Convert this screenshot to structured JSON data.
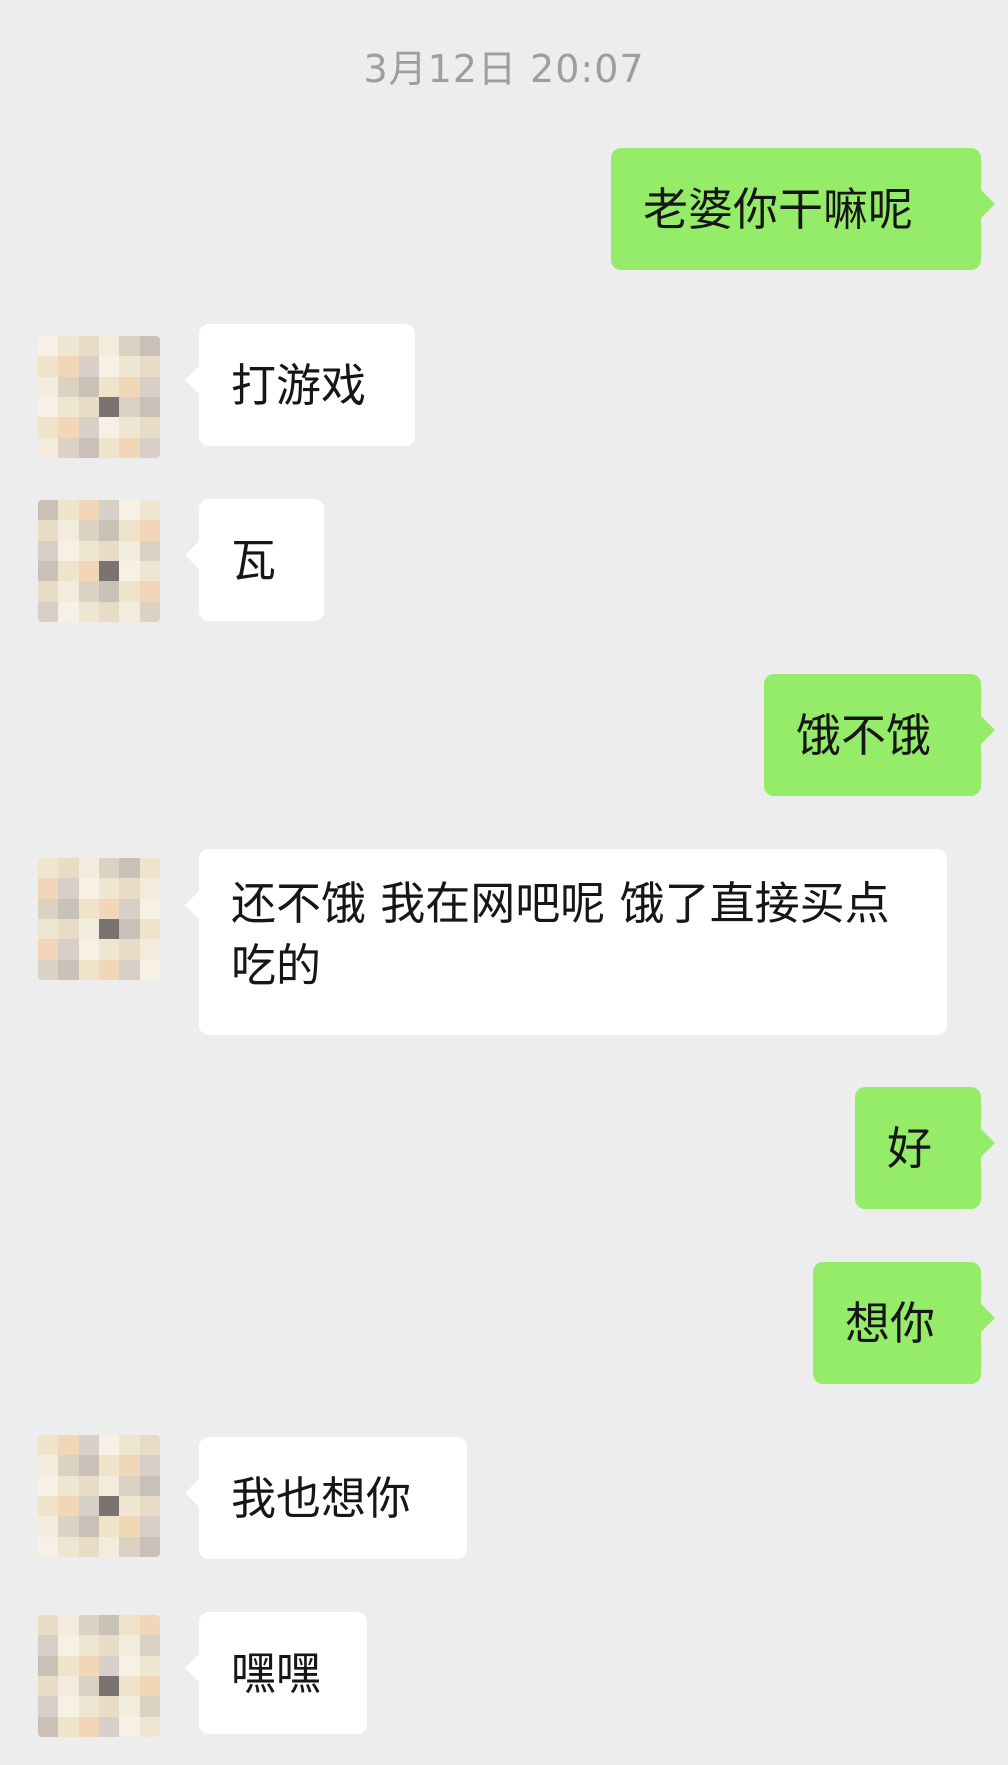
{
  "chat": {
    "timestamp": "3月12日 20:07",
    "messages": [
      {
        "side": "sent",
        "text": "老婆你干嘛呢"
      },
      {
        "side": "received",
        "text": "打游戏"
      },
      {
        "side": "received",
        "text": "瓦"
      },
      {
        "side": "sent",
        "text": "饿不饿"
      },
      {
        "side": "received",
        "text": "还不饿 我在网吧呢 饿了直接买点吃的"
      },
      {
        "side": "sent",
        "text": "好"
      },
      {
        "side": "sent",
        "text": "想你"
      },
      {
        "side": "received",
        "text": "我也想你"
      },
      {
        "side": "received",
        "text": "嘿嘿"
      }
    ]
  },
  "avatar": {
    "style": "pixelated-blurred",
    "palette": [
      "#f6f1e4",
      "#efe6d2",
      "#e9dcc6",
      "#f3ecdc",
      "#dcd2c3",
      "#c9c0b7",
      "#efe4c9",
      "#f1d7b8",
      "#d7cfc8"
    ],
    "dark_pixel_color": "#7a7370"
  }
}
